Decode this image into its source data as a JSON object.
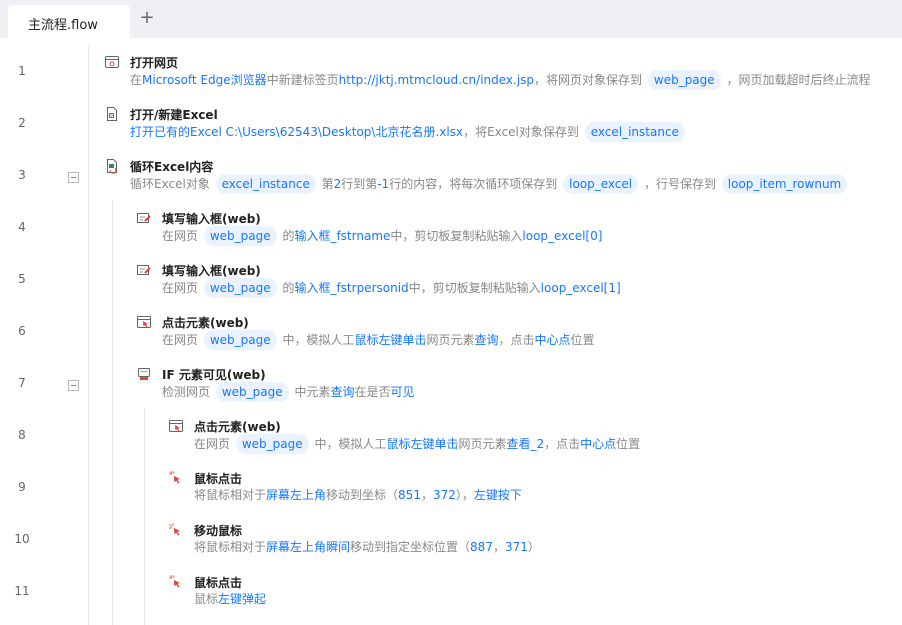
{
  "tabs": {
    "active_label": "主流程.flow",
    "add_icon": "plus-icon"
  },
  "rows": [
    {
      "no": "1",
      "title": "打开网页",
      "icon": "browser-window-icon",
      "desc": [
        {
          "t": "在"
        },
        {
          "k": "Microsoft Edge浏览器"
        },
        {
          "t": "中新建标签页"
        },
        {
          "k": "http://jktj.mtmcloud.cn/index.jsp"
        },
        {
          "t": "，将网页对象保存到 "
        },
        {
          "p": "web_page"
        },
        {
          "t": " ，网页加载超时后终止流程"
        }
      ]
    },
    {
      "no": "2",
      "title": "打开/新建Excel",
      "icon": "excel-file-icon",
      "desc": [
        {
          "k": "打开已有的Excel C:\\Users\\62543\\Desktop\\北京花名册.xlsx"
        },
        {
          "t": "，将Excel对象保存到 "
        },
        {
          "p": "excel_instance"
        }
      ]
    },
    {
      "no": "3",
      "title": "循环Excel内容",
      "icon": "excel-loop-icon",
      "desc": [
        {
          "t": "循环Excel对象 "
        },
        {
          "p": "excel_instance"
        },
        {
          "t": " 第"
        },
        {
          "k": "2"
        },
        {
          "t": "行到第"
        },
        {
          "k": "-1"
        },
        {
          "t": "行的内容，将每次循环项保存到 "
        },
        {
          "p": "loop_excel"
        },
        {
          "t": " ，行号保存到 "
        },
        {
          "p": "loop_item_rownum"
        }
      ]
    },
    {
      "no": "4",
      "title": "填写输入框(web)",
      "icon": "input-edit-icon",
      "desc": [
        {
          "t": "在网页 "
        },
        {
          "p": "web_page"
        },
        {
          "t": " 的"
        },
        {
          "k": "输入框_fstrname"
        },
        {
          "t": "中，剪切板复制粘贴输入"
        },
        {
          "k": "loop_excel[0]"
        }
      ]
    },
    {
      "no": "5",
      "title": "填写输入框(web)",
      "icon": "input-edit-icon",
      "desc": [
        {
          "t": "在网页 "
        },
        {
          "p": "web_page"
        },
        {
          "t": " 的"
        },
        {
          "k": "输入框_fstrpersonid"
        },
        {
          "t": "中，剪切板复制粘贴输入"
        },
        {
          "k": "loop_excel[1]"
        }
      ]
    },
    {
      "no": "6",
      "title": "点击元素(web)",
      "icon": "click-element-icon",
      "desc": [
        {
          "t": "在网页 "
        },
        {
          "p": "web_page"
        },
        {
          "t": " 中，模拟人工"
        },
        {
          "k": "鼠标左键单击"
        },
        {
          "t": "网页元素"
        },
        {
          "k": "查询"
        },
        {
          "t": "，点击"
        },
        {
          "k": "中心点"
        },
        {
          "t": "位置"
        }
      ]
    },
    {
      "no": "7",
      "title": "IF 元素可见(web)",
      "icon": "if-visible-icon",
      "desc": [
        {
          "t": "检测网页 "
        },
        {
          "p": "web_page"
        },
        {
          "t": " 中元素"
        },
        {
          "k": "查询"
        },
        {
          "t": "在是否"
        },
        {
          "k": "可见"
        }
      ]
    },
    {
      "no": "8",
      "title": "点击元素(web)",
      "icon": "click-element-icon",
      "desc": [
        {
          "t": "在网页 "
        },
        {
          "p": "web_page"
        },
        {
          "t": " 中，模拟人工"
        },
        {
          "k": "鼠标左键单击"
        },
        {
          "t": "网页元素"
        },
        {
          "k": "查看_2"
        },
        {
          "t": "，点击"
        },
        {
          "k": "中心点"
        },
        {
          "t": "位置"
        }
      ]
    },
    {
      "no": "9",
      "title": "鼠标点击",
      "icon": "mouse-click-icon",
      "desc": [
        {
          "t": "将鼠标相对于"
        },
        {
          "k": "屏幕左上角"
        },
        {
          "t": "移动到坐标（"
        },
        {
          "k": "851"
        },
        {
          "t": "，"
        },
        {
          "k": "372"
        },
        {
          "t": "），"
        },
        {
          "k": "左键按下"
        }
      ]
    },
    {
      "no": "10",
      "title": "移动鼠标",
      "icon": "mouse-move-icon",
      "desc": [
        {
          "t": "将鼠标相对于"
        },
        {
          "k": "屏幕左上角瞬间"
        },
        {
          "t": "移动到指定坐标位置（"
        },
        {
          "k": "887"
        },
        {
          "t": "，"
        },
        {
          "k": "371"
        },
        {
          "t": "）"
        }
      ]
    },
    {
      "no": "11",
      "title": "鼠标点击",
      "icon": "mouse-click-icon",
      "desc": [
        {
          "t": "鼠标"
        },
        {
          "k": "左键弹起"
        }
      ]
    }
  ]
}
